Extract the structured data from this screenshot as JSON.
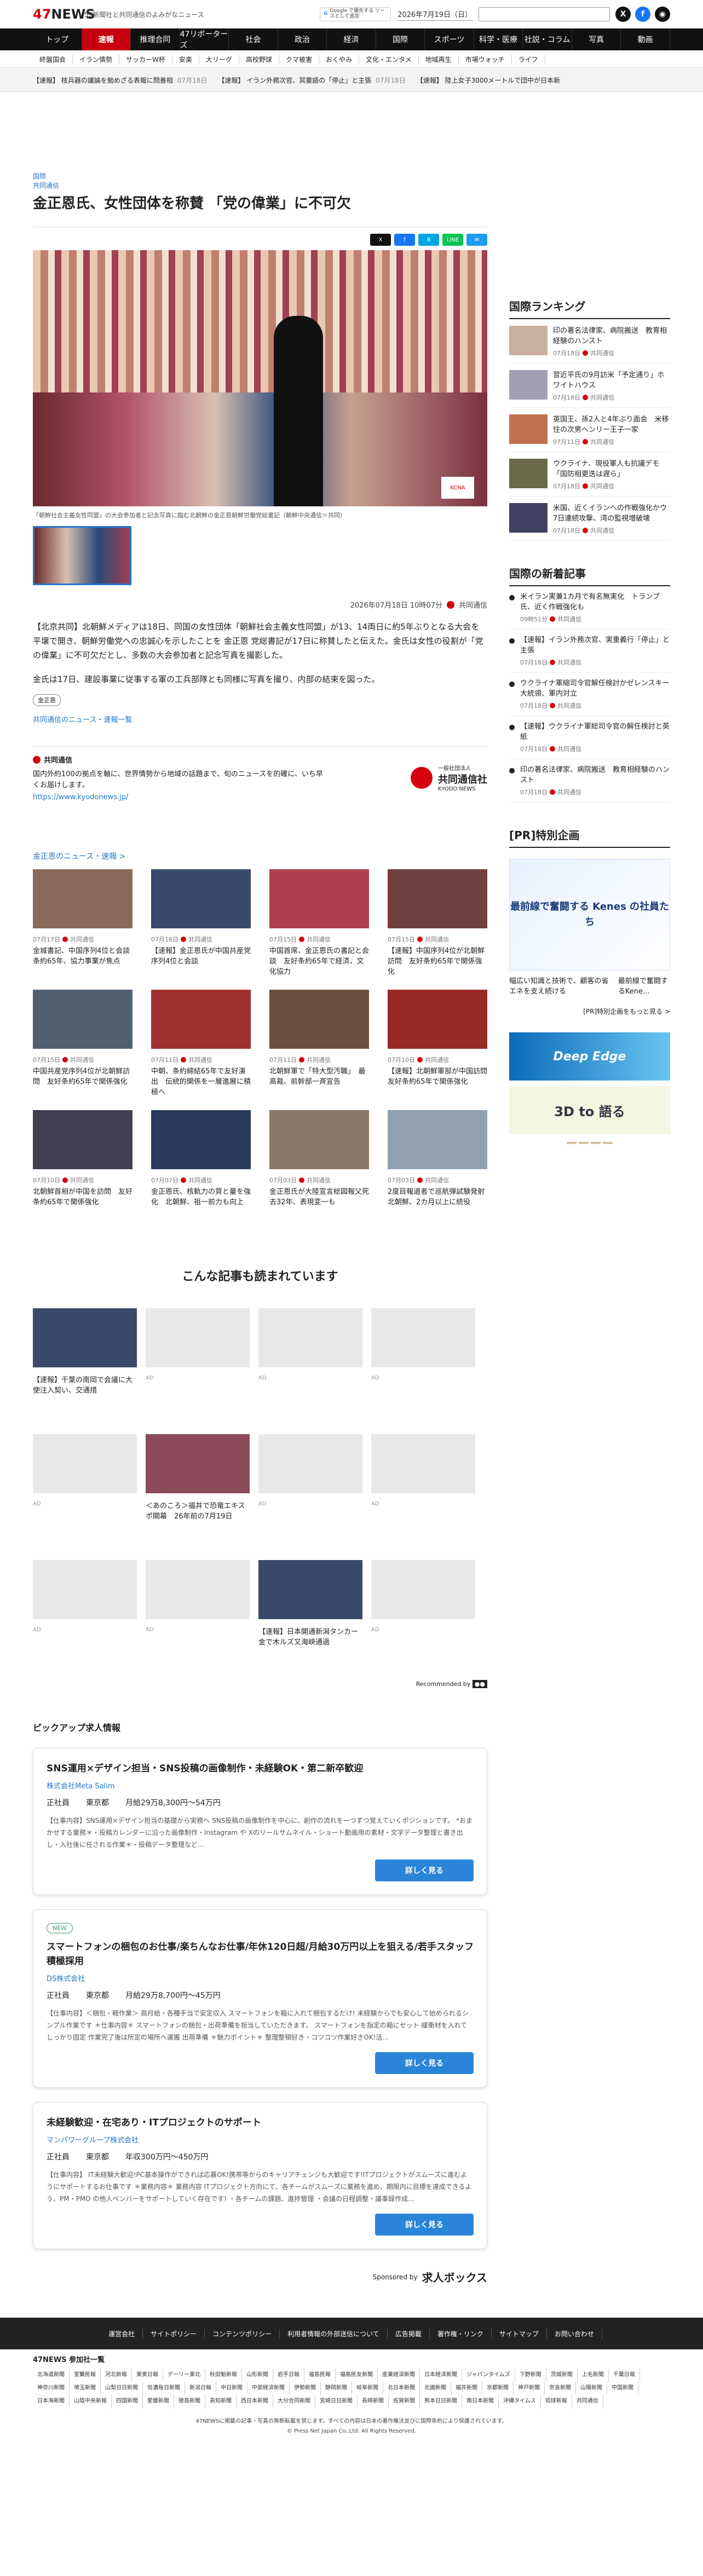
{
  "header": {
    "logo": "47NEWS",
    "tagline": "52新聞社と共同通信のよみがなニュース",
    "google_badge": "Google で優先する ソースとして追加",
    "date": "2026年7月19日（日）"
  },
  "nav": [
    "トップ",
    "速報",
    "推理合同",
    "47リポーターズ",
    "社会",
    "政治",
    "経済",
    "国際",
    "スポーツ",
    "科学・医療",
    "社説・コラム",
    "写真",
    "動画"
  ],
  "subnav": [
    "終盤国会",
    "イラン情勢",
    "サッカーW杯",
    "安楽",
    "大リーグ",
    "高校野球",
    "クマ被害",
    "おくやみ",
    "文化・エンタメ",
    "地域再生",
    "市場ウォッチ",
    "ライフ"
  ],
  "ticker": [
    {
      "text": "【速報】 枝兵器の議論を勉めざる表報に問善相",
      "date": "07月18日"
    },
    {
      "text": "【速報】 イラン外務次官、冥重語の「停止」と主張",
      "date": "07月18日"
    },
    {
      "text": "【速報】 陸上女子3000メートルで団中が日本新",
      "date": ""
    }
  ],
  "article": {
    "category": "国際",
    "source_label": "共同通信",
    "title": "金正恩氏、女性団体を称賛 「党の偉業」に不可欠",
    "share": [
      "X",
      "f",
      "B",
      "LINE",
      "✉"
    ],
    "caption": "「朝鮮社会主義女性同盟」の大会参加者と記念写真に臨む北朝鮮の金正恩朝鮮労働党総書記（朝鮮中央通信＝共同）",
    "datetime": "2026年07月18日 10時07分",
    "publisher": "共同通信",
    "paragraphs": [
      "【北京共同】北朝鮮メディアは18日、同国の女性団体「朝鮮社会主義女性同盟」が13、14両日に約5年ぶりとなる大会を平壌で開き、朝鮮労働党への忠誠心を示したことを 金正恩 党総書記が17日に称賛したと伝えた。金氏は女性の役割が「党の偉業」に不可欠だとし、多数の大会参加者と記念写真を撮影した。",
      "金氏は17日、建設事業に従事する軍の工兵部隊とも同様に写真を撮り、内部の結束を図った。"
    ],
    "tag": "金正恩",
    "more_link": "共同通信のニュース・速報一覧"
  },
  "kyodo": {
    "title": "共同通信",
    "desc": "国内外約100の拠点を軸に、世界情勢から地域の話題まで、旬のニュースを的確に、いち早くお届けします。",
    "url": "https://www.kyodonews.jp/",
    "brand": "共同通信社",
    "brand_en": "KYODO NEWS",
    "brand_small": "一般社団法人"
  },
  "related": {
    "heading": "金正恩のニュース・速報 >",
    "items": [
      {
        "date": "07月17日",
        "title": "金城書記、中国序列4位と会談　条約65年、協力事業が焦点"
      },
      {
        "date": "07月16日",
        "title": "【速報】金正恩氏が中国共産党序列4位と会談"
      },
      {
        "date": "07月15日",
        "title": "中国首席、金正恩氏の書記と会談　友好条約65年で経済、文化協力"
      },
      {
        "date": "07月15日",
        "title": "【速報】中国序列4位が北朝鮮訪問　友好条約65年で関係強化"
      },
      {
        "date": "07月15日",
        "title": "中国共産党序列4位が北朝鮮訪問　友好条約65年で関係強化"
      },
      {
        "date": "07月11日",
        "title": "中朝、条約締結65年で友好演出　伝統的関係を一層進展に積極へ"
      },
      {
        "date": "07月11日",
        "title": "北朝鮮軍で「特大型汚職」　最高裁、前幹部一斉宣告"
      },
      {
        "date": "07月10日",
        "title": "【速報】北朝鮮軍部が中国訪問　友好条約65年で関係強化"
      },
      {
        "date": "07月10日",
        "title": "北朝鮮首相が中国を訪問　友好条約65年で関係強化"
      },
      {
        "date": "07月07日",
        "title": "金正恩氏、核軌力の質と量を強化　北朝鮮、祖一前力も向上"
      },
      {
        "date": "07月03日",
        "title": "金正恩氏が大陸宣言総図報父死去32年、表現変一も"
      },
      {
        "date": "07月03日",
        "title": "2度目報道者で巡航弾試験発射　北朝鮮、2カ月以上に統役"
      }
    ]
  },
  "read_more": {
    "heading": "こんな記事も読まれています",
    "items": [
      {
        "title": "【速報】千葉の南岡で会議に大使注入契い、交通措",
        "extra": ""
      },
      {
        "title": "",
        "extra": "AD"
      },
      {
        "title": "",
        "extra": "AD"
      },
      {
        "title": "",
        "extra": "AD"
      },
      {
        "title": "",
        "extra": "AD"
      },
      {
        "title": "＜あのころ＞福井で恐竜エキスポ開幕　26年前の7月19日",
        "extra": ""
      },
      {
        "title": "",
        "extra": "AD"
      },
      {
        "title": "",
        "extra": "AD"
      },
      {
        "title": "",
        "extra": "AD"
      },
      {
        "title": "",
        "extra": "AD"
      },
      {
        "title": "【速報】日本開通新潟タンカー金で木ルズ又海峡通過",
        "extra": ""
      },
      {
        "title": "",
        "extra": "AD"
      }
    ],
    "recommended": "Recommended by"
  },
  "jobs": {
    "heading": "ピックアップ求人情報",
    "items": [
      {
        "new": "",
        "title": "SNS運用×デザイン担当・SNS投稿の画像制作・未経験OK・第二新卒歓迎",
        "company": "株式会社Meta Salim",
        "type": "正社員",
        "place": "東京都",
        "salary": "月給29万8,300円〜54万円",
        "desc": "【仕事内容】SNS運用×デザイン担当の基礎から実務へ SNS投稿の画像制作を中心に、創作の流れを一つずつ覚えていくポジションです。 *おまかせする業務＊・投稿カレンダーに沿った画像制作・Instagram や Xのリールサムネイル・ショート動画用の素材・文字データ整理と書き出し・入社後に任される作業＊・投稿データ整理など...",
        "button": "詳しく見る"
      },
      {
        "new": "NEW",
        "title": "スマートフォンの梱包のお仕事/楽ちんなお仕事/年休120日超/月給30万円以上を狙える/若手スタッフ積極採用",
        "company": "DS株式会社",
        "type": "正社員",
        "place": "東京都",
        "salary": "月給29万8,700円〜45万円",
        "desc": "【仕事内容】＜梱包・軽作業＞ 高月給・各種手当で安定収入 スマートフォンを箱に入れて梱包するだけ! 未経験からでも安心して始められるシンプル作業です ＊仕事内容＊ スマートフォンの梱包・出荷準備を担当していただきます。 スマートフォンを指定の箱にセット 緩衝材を入れてしっかり固定 作業完了後は所定の場所へ運搬 出荷準備 ＊魅力ポイント＊ 整理整頓好き・コツコツ作業好きOK!活...",
        "button": "詳しく見る"
      },
      {
        "new": "",
        "title": "未経験歓迎・在宅あり・ITプロジェクトのサポート",
        "company": "マンパワーグループ株式会社",
        "type": "正社員",
        "place": "東京都",
        "salary": "年収300万円〜450万円",
        "desc": "【仕事内容】 IT未経験大歓迎!PC基本操作ができれば応募OK!携帯等からのキャリアチェンジも大歓迎です!ITプロジェクトがスムーズに進むようにサポートするお仕事です ＊業務内容＊ 業務内容 ITプロジェクト方向にて、各チームがスムーズに業務を進め、期限内に目標を達成できるよう、PM・PMO の他人ペンバーをサポートしていく存在です! ・各チームの課題、進捗管理 ・会議の日程調整・議事録作成...",
        "button": "詳しく見る"
      }
    ],
    "sponsor_label": "Sponsored by",
    "sponsor": "求人ボックス"
  },
  "sidebar": {
    "ranking_h": "国際ランキング",
    "ranking": [
      {
        "title": "印の著名法律家、病院搬送　教育相経験のハンスト",
        "date": "07月18日"
      },
      {
        "title": "習近平氏の9月訪米「予定通り」ホワイトハウス",
        "date": "07月18日"
      },
      {
        "title": "英国王、孫2人と4年ぶり面会　米移住の次男ヘンリー王子一家",
        "date": "07月11日"
      },
      {
        "title": "ウクライナ、現役軍人も抗議デモ「国防相更迭は遅ら」",
        "date": "07月18日"
      },
      {
        "title": "米国、近くイランへの作戦強化かウ7日連続攻撃、湾の監視増破壊",
        "date": "07月18日"
      }
    ],
    "newest_h": "国際の新着記事",
    "newest": [
      {
        "title": "米イラン実兼1カ月で有名無実化　トランプ氏、近く作戦強化も",
        "date": "09時51分"
      },
      {
        "title": "【速報】イラン外務次官、実重義行「停止」と主張",
        "date": "07月18日"
      },
      {
        "title": "ウクライナ軍縮司令官解任検討かゼレンスキー大統領、軍内対立",
        "date": "07月18日"
      },
      {
        "title": "【速報】ウクライナ軍総司令官の解任検討と英紙",
        "date": "07月18日"
      },
      {
        "title": "印の著名法律家、病院搬送　教育相経験のハンスト",
        "date": "07月18日"
      }
    ],
    "pr_h": "[PR]特別企画",
    "pr_slide": "最前線で奮闘する Kenes の社員たち",
    "pr_caps": [
      "幅広い知識と技術で、顧客の省エネを支え続ける",
      "最前線で奮闘するKene..."
    ],
    "pr_more": "[PR]特別企画をもっと見る >",
    "ad1": "Deep Edge",
    "ad2": "3D to 語る"
  },
  "footer": {
    "links": [
      "運営会社",
      "サイトポリシー",
      "コンテンツポリシー",
      "利用者情報の外部送信について",
      "広告掲載",
      "著作権・リンク",
      "サイトマップ",
      "お問い合わせ"
    ],
    "members_h": "47NEWS 参加社一覧",
    "members": [
      "北海道新聞",
      "室蘭民報",
      "河北新報",
      "東奥日報",
      "デーリー東北",
      "秋田魁新報",
      "山形新聞",
      "岩手日報",
      "福島民報",
      "福島民友新聞",
      "産業経済新聞",
      "日本経済新聞",
      "ジャパンタイムズ",
      "下野新聞",
      "茨城新聞",
      "上毛新聞",
      "千葉日報",
      "神奈川新聞",
      "埼玉新聞",
      "山梨日日新聞",
      "信濃毎日新聞",
      "新潟日報",
      "中日新聞",
      "中部経済新聞",
      "伊勢新聞",
      "静岡新聞",
      "岐阜新聞",
      "北日本新聞",
      "北國新聞",
      "福井新聞",
      "京都新聞",
      "神戸新聞",
      "奈良新聞",
      "山陽新聞",
      "中国新聞",
      "日本海新聞",
      "山陰中央新報",
      "四国新聞",
      "愛媛新聞",
      "徳島新聞",
      "高知新聞",
      "西日本新聞",
      "大分合同新聞",
      "宮崎日日新聞",
      "長崎新聞",
      "佐賀新聞",
      "熊本日日新聞",
      "南日本新聞",
      "沖縄タイムス",
      "琉球新報",
      "共同通信"
    ],
    "copyright": "47NEWSに掲載の記事・写真の無断転載を禁じます。すべての内容は日本の著作権法並びに国際条約により保護されています。",
    "copyright2": "© Press Net Japan Co.,Ltd. All Rights Reserved."
  },
  "colors": {
    "brand_red": "#d7000f",
    "link_blue": "#2277cc",
    "button_blue": "#2a85d8"
  }
}
